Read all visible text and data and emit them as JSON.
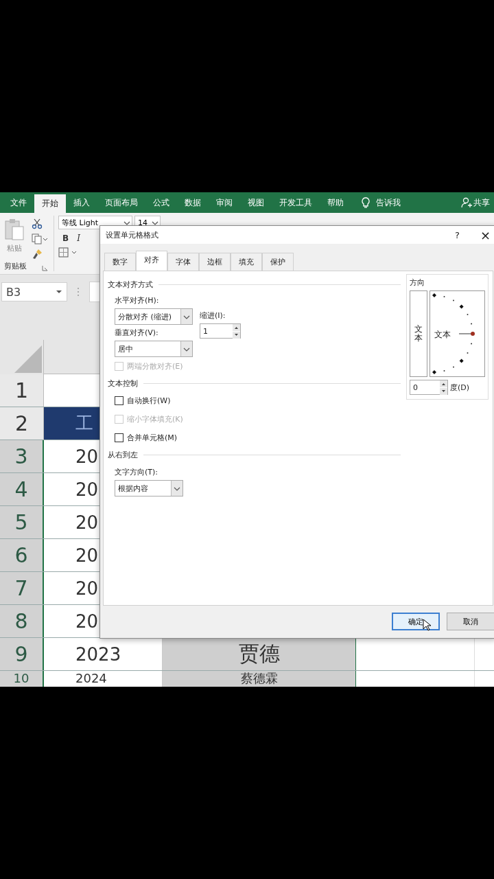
{
  "ribbon": {
    "tabs": [
      {
        "label": "文件",
        "selected": false
      },
      {
        "label": "开始",
        "selected": true
      },
      {
        "label": "插入",
        "selected": false
      },
      {
        "label": "页面布局",
        "selected": false
      },
      {
        "label": "公式",
        "selected": false
      },
      {
        "label": "数据",
        "selected": false
      },
      {
        "label": "审阅",
        "selected": false
      },
      {
        "label": "视图",
        "selected": false
      },
      {
        "label": "开发工具",
        "selected": false
      },
      {
        "label": "帮助",
        "selected": false
      }
    ],
    "tell_me": "告诉我",
    "share": "共享",
    "clipboard": {
      "paste": "粘贴",
      "group": "剪贴板"
    },
    "font": {
      "name": "等线 Light",
      "size": "14",
      "bold": "B",
      "italic": "I"
    }
  },
  "name_box": "B3",
  "sheet": {
    "rows": [
      {
        "number": "1",
        "selected": false,
        "kind": "blank"
      },
      {
        "number": "2",
        "selected": false,
        "kind": "header",
        "col_a": "工"
      },
      {
        "number": "3",
        "selected": true,
        "kind": "data",
        "col_a": "20"
      },
      {
        "number": "4",
        "selected": true,
        "kind": "data",
        "col_a": "20"
      },
      {
        "number": "5",
        "selected": true,
        "kind": "data",
        "col_a": "20"
      },
      {
        "number": "6",
        "selected": true,
        "kind": "data",
        "col_a": "20"
      },
      {
        "number": "7",
        "selected": true,
        "kind": "data",
        "col_a": "20"
      },
      {
        "number": "8",
        "selected": true,
        "kind": "data",
        "col_a": "20"
      },
      {
        "number": "9",
        "selected": true,
        "kind": "data",
        "col_a": "2023",
        "col_b": "贾德"
      },
      {
        "number": "10",
        "selected": true,
        "kind": "data",
        "col_a": "2024",
        "col_b": "蔡德霖"
      }
    ]
  },
  "dialog": {
    "title": "设置单元格格式",
    "help": "?",
    "close": "×",
    "tabs": [
      {
        "label": "数字",
        "selected": false
      },
      {
        "label": "对齐",
        "selected": true
      },
      {
        "label": "字体",
        "selected": false
      },
      {
        "label": "边框",
        "selected": false
      },
      {
        "label": "填充",
        "selected": false
      },
      {
        "label": "保护",
        "selected": false
      }
    ],
    "alignment": {
      "title": "文本对齐方式",
      "horizontal": {
        "label": "水平对齐(H):",
        "value": "分散对齐 (缩进)"
      },
      "indent": {
        "label": "缩进(I):",
        "value": "1"
      },
      "vertical": {
        "label": "垂直对齐(V):",
        "value": "居中"
      },
      "distributed": {
        "label": "两端分散对齐(E)",
        "checked": false,
        "disabled": true
      }
    },
    "text_control": {
      "title": "文本控制",
      "options": [
        {
          "label": "自动换行(W)",
          "checked": false,
          "disabled": false
        },
        {
          "label": "缩小字体填充(K)",
          "checked": false,
          "disabled": true
        },
        {
          "label": "合并单元格(M)",
          "checked": false,
          "disabled": false
        }
      ]
    },
    "rtl": {
      "title": "从右到左",
      "direction": {
        "label": "文字方向(T):",
        "value": "根据内容"
      }
    },
    "orientation": {
      "title": "方向",
      "vertical_text": "文本",
      "dial_text": "文本",
      "degrees": "0",
      "degrees_label": "度(D)"
    },
    "buttons": [
      {
        "label": "确定",
        "focused": true
      },
      {
        "label": "取消",
        "focused": false
      }
    ]
  }
}
